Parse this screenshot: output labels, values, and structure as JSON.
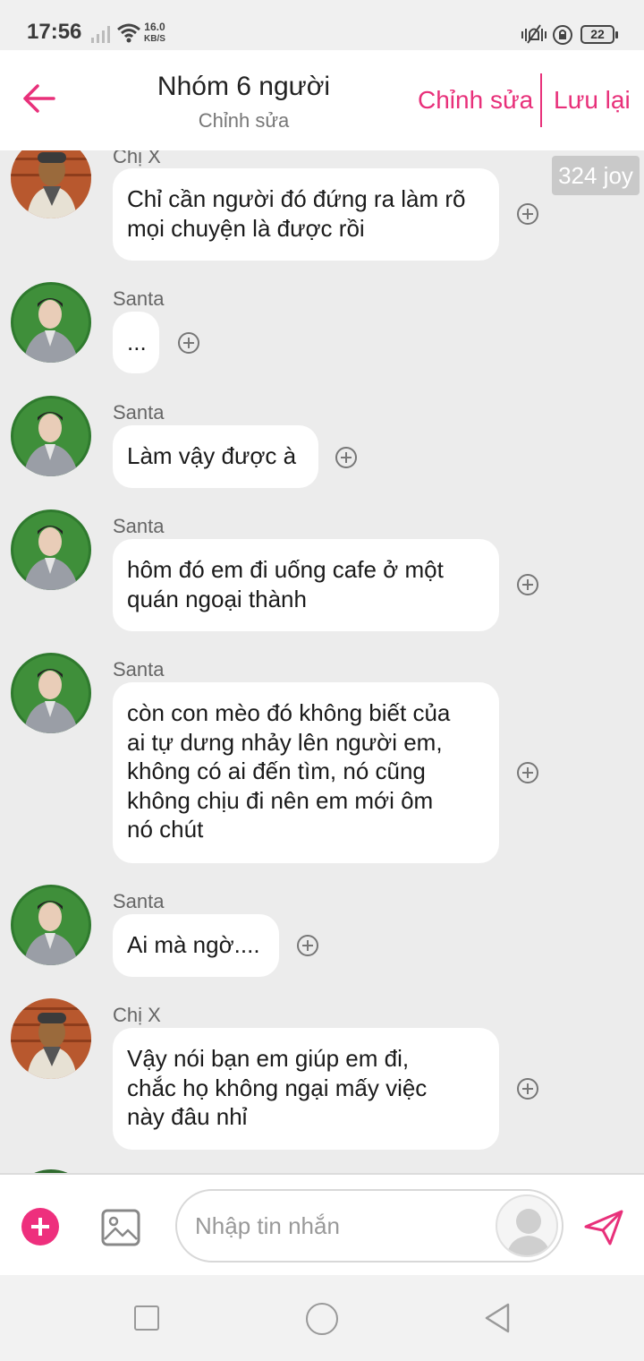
{
  "status_bar": {
    "time": "17:56",
    "net_speed_value": "16.0",
    "net_speed_unit": "KB/S",
    "battery": "22"
  },
  "header": {
    "title": "Nhóm 6 người",
    "subtitle": "Chỉnh sửa",
    "edit_label": "Chỉnh sửa",
    "save_label": "Lưu lại"
  },
  "badge": {
    "joy": "324 joy"
  },
  "messages": [
    {
      "sender": "Chị X",
      "text": "Chỉ cần người đó đứng ra làm rõ\nmọi chuyện là được rồi"
    },
    {
      "sender": "Santa",
      "text": "..."
    },
    {
      "sender": "Santa",
      "text": "Làm vậy được à"
    },
    {
      "sender": "Santa",
      "text": "hôm đó em đi uống cafe ở một\nquán ngoại thành"
    },
    {
      "sender": "Santa",
      "text": "còn con mèo đó không biết của\nai tự dưng nhảy lên người em,\nkhông có ai đến tìm, nó cũng\nkhông chịu đi nên em mới ôm\nnó chút"
    },
    {
      "sender": "Santa",
      "text": "Ai mà ngờ...."
    },
    {
      "sender": "Chị X",
      "text": "Vậy nói bạn em giúp em đi,\nchắc họ không ngại mấy việc\nnày đâu nhỉ"
    }
  ],
  "input": {
    "placeholder": "Nhập tin nhắn"
  },
  "colors": {
    "accent": "#e8307a",
    "background": "#ececec",
    "bubble": "#ffffff"
  }
}
